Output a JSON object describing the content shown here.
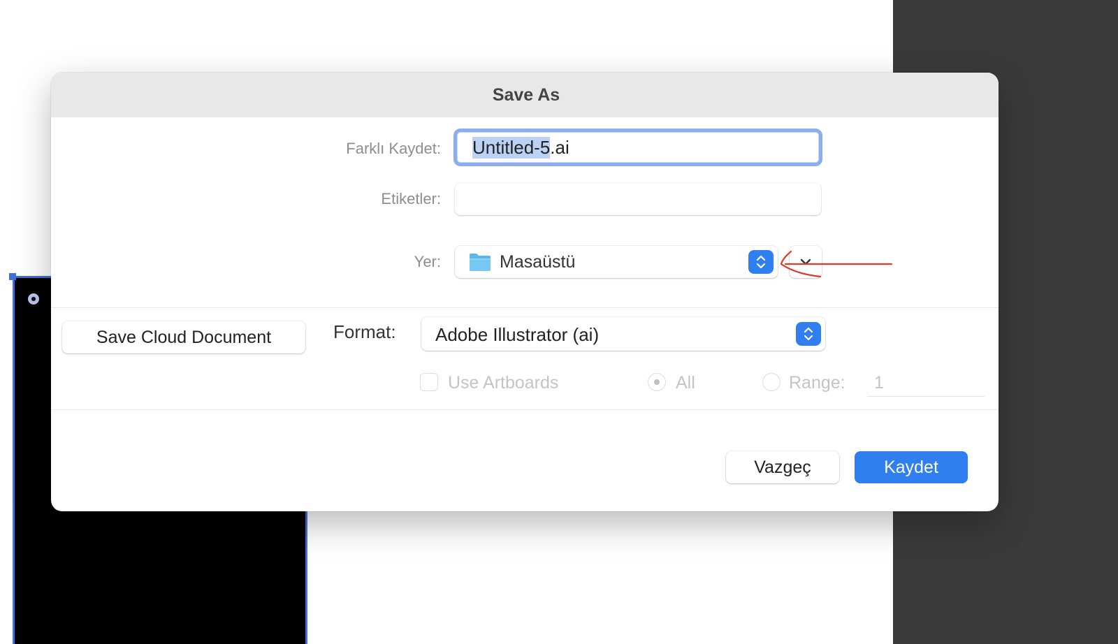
{
  "dialog": {
    "title": "Save As",
    "save_as_label": "Farklı Kaydet:",
    "filename_selected": "Untitled-5",
    "filename_extension": ".ai",
    "tags_label": "Etiketler:",
    "tags_value": "",
    "location_label": "Yer:",
    "location_value": "Masaüstü",
    "cloud_button_label": "Save Cloud Document",
    "format_label": "Format:",
    "format_value": "Adobe Illustrator (ai)",
    "use_artboards_label": "Use Artboards",
    "all_label": "All",
    "range_label": "Range:",
    "range_value": "1",
    "cancel_label": "Vazgeç",
    "save_label": "Kaydet"
  },
  "colors": {
    "accent": "#2f7ff0",
    "annotation": "#e0392b",
    "side_panel": "#3a3a3a"
  },
  "icons": {
    "location_folder": "folder-icon",
    "location_stepper": "up-down-stepper-icon",
    "expand": "chevron-down-icon",
    "format_stepper": "up-down-stepper-icon",
    "annotation": "hand-drawn-arrow-icon"
  },
  "state": {
    "use_artboards_checked": false,
    "artboard_range_mode": "All"
  }
}
